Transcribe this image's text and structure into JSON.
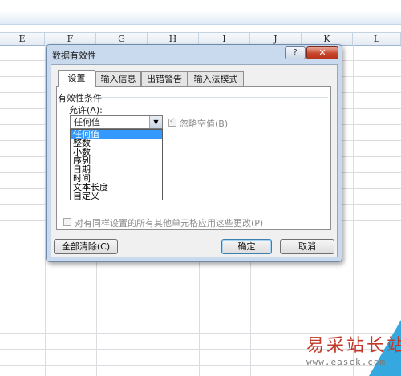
{
  "columns": [
    "E",
    "F",
    "G",
    "H",
    "I",
    "J",
    "K",
    "L"
  ],
  "dialog": {
    "title": "数据有效性",
    "help_label": "?",
    "close_label": "✕",
    "tabs": [
      {
        "label": "设置",
        "active": true
      },
      {
        "label": "输入信息",
        "active": false
      },
      {
        "label": "出错警告",
        "active": false
      },
      {
        "label": "输入法模式",
        "active": false
      }
    ],
    "section_title": "有效性条件",
    "allow_label": "允许(A):",
    "allow_value": "任何值",
    "allow_options": [
      "任何值",
      "整数",
      "小数",
      "序列",
      "日期",
      "时间",
      "文本长度",
      "自定义"
    ],
    "ignore_blank_label": "忽略空值(B)",
    "apply_all_label": "对有同样设置的所有其他单元格应用这些更改(P)",
    "clear_all_label": "全部清除(C)",
    "ok_label": "确定",
    "cancel_label": "取消"
  },
  "watermark": {
    "brand": "易采站长站",
    "url": "www.easck.com"
  }
}
